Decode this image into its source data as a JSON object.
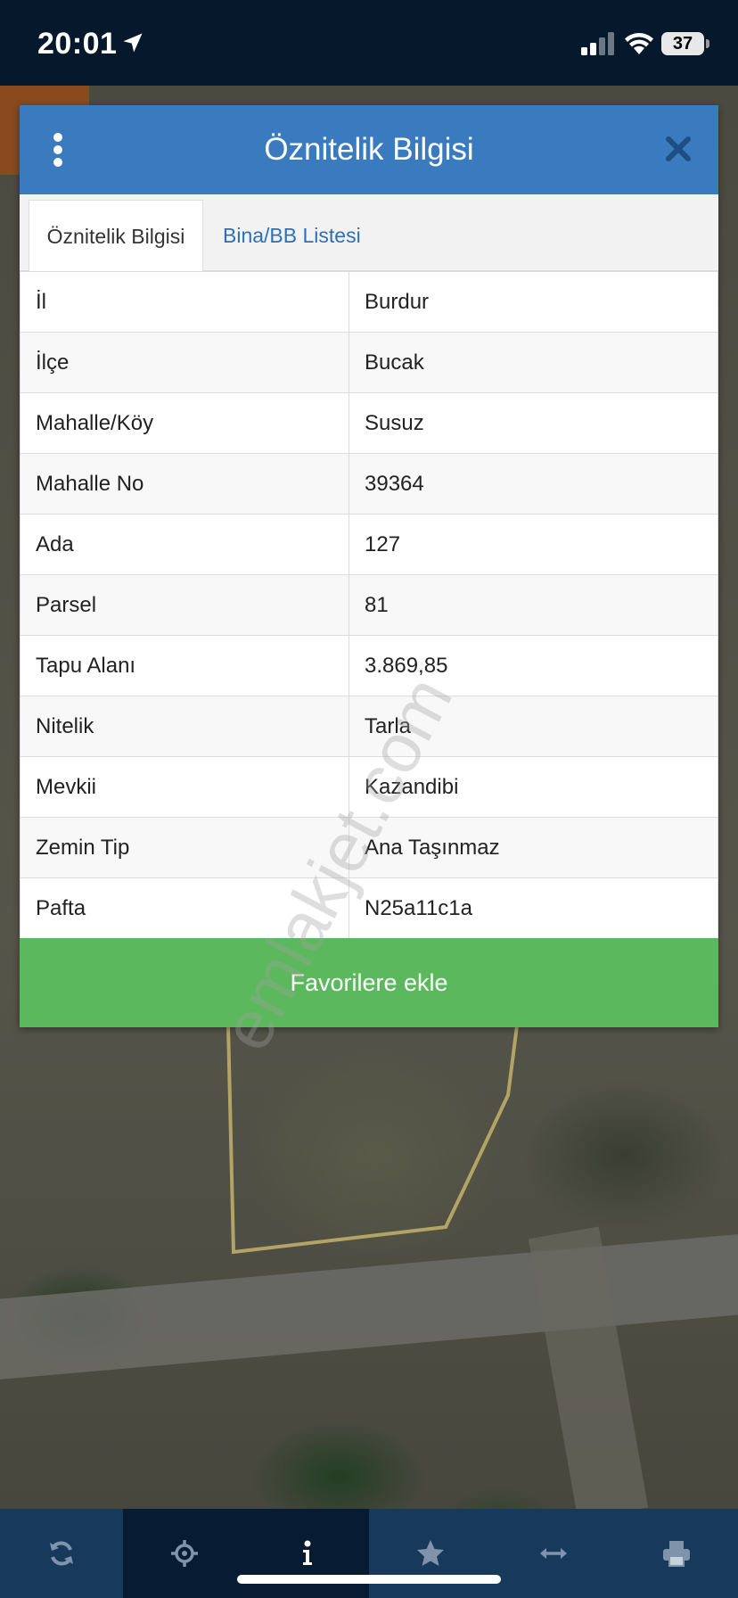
{
  "status_bar": {
    "time": "20:01",
    "battery": "37",
    "icons": [
      "location-arrow-icon",
      "signal-icon",
      "wifi-icon",
      "battery-icon"
    ]
  },
  "dialog": {
    "title": "Öznitelik Bilgisi",
    "tabs": [
      {
        "label": "Öznitelik Bilgisi",
        "active": true
      },
      {
        "label": "Bina/BB Listesi",
        "active": false
      }
    ],
    "rows": [
      {
        "key": "İl",
        "value": "Burdur"
      },
      {
        "key": "İlçe",
        "value": "Bucak"
      },
      {
        "key": "Mahalle/Köy",
        "value": "Susuz"
      },
      {
        "key": "Mahalle No",
        "value": "39364"
      },
      {
        "key": "Ada",
        "value": "127"
      },
      {
        "key": "Parsel",
        "value": "81"
      },
      {
        "key": "Tapu Alanı",
        "value": "3.869,85"
      },
      {
        "key": "Nitelik",
        "value": "Tarla"
      },
      {
        "key": "Mevkii",
        "value": "Kazandibi"
      },
      {
        "key": "Zemin Tip",
        "value": "Ana Taşınmaz"
      },
      {
        "key": "Pafta",
        "value": "N25a11c1a"
      }
    ],
    "favorite_button": "Favorilere ekle"
  },
  "watermark": "emlakjet.com",
  "toolbar": {
    "items": [
      "refresh-icon",
      "crosshair-icon",
      "info-icon",
      "star-icon",
      "measure-icon",
      "print-icon"
    ]
  },
  "colors": {
    "header": "#3a7bbf",
    "button": "#5cb85c",
    "toolbar": "#173a5c",
    "tab_link": "#2f70b5"
  }
}
